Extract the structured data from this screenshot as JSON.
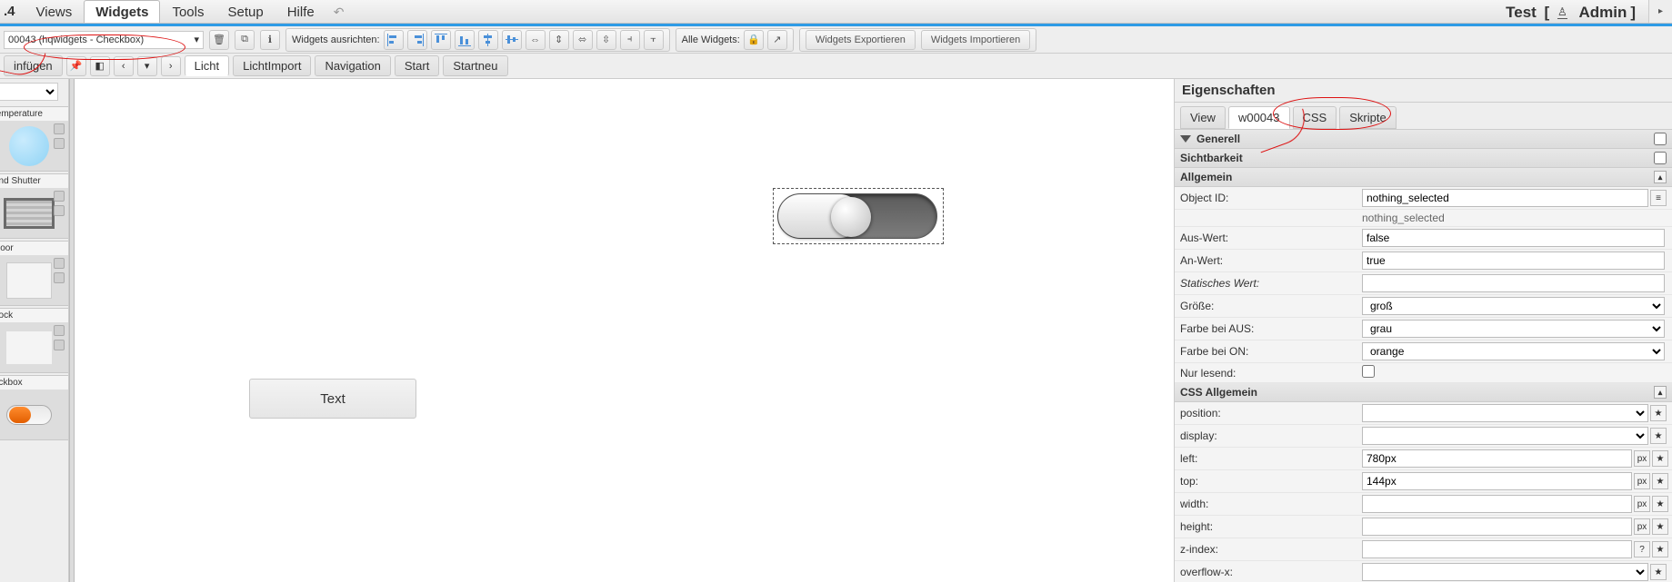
{
  "app": {
    "version": ".4",
    "title_right": "Test",
    "user": "Admin"
  },
  "menu": {
    "views": "Views",
    "widgets": "Widgets",
    "tools": "Tools",
    "setup": "Setup",
    "help": "Hilfe"
  },
  "toolbar2": {
    "widget_selector": "00043 (hqwidgets - Checkbox)",
    "align_label": "Widgets ausrichten:",
    "all_widgets_label": "Alle Widgets:",
    "export": "Widgets Exportieren",
    "import": "Widgets Importieren"
  },
  "tabbar": {
    "insert": "infügen",
    "tabs": [
      "Licht",
      "LichtImport",
      "Navigation",
      "Start",
      "Startneu"
    ],
    "active": 0
  },
  "palette": {
    "items": [
      {
        "label": "temperature"
      },
      {
        "label": "and Shutter"
      },
      {
        "label": "Door"
      },
      {
        "label": "Lock"
      },
      {
        "label": "eckbox"
      }
    ]
  },
  "canvas": {
    "text_widget": "Text"
  },
  "props": {
    "title": "Eigenschaften",
    "tab_view": "View",
    "tab_widget": "w00043",
    "tab_css": "CSS",
    "tab_scripts": "Skripte",
    "active": 1,
    "groups": {
      "general": "Generell",
      "visibility": "Sichtbarkeit",
      "common": "Allgemein",
      "css_common": "CSS Allgemein"
    },
    "common": {
      "oid_label": "Object ID:",
      "oid_value": "nothing_selected",
      "oid_hint": "nothing_selected",
      "off_label": "Aus-Wert:",
      "off_value": "false",
      "on_label": "An-Wert:",
      "on_value": "true",
      "static_label": "Statisches Wert:",
      "static_value": "",
      "size_label": "Größe:",
      "size_value": "groß",
      "off_color_label": "Farbe bei AUS:",
      "off_color_value": "grau",
      "on_color_label": "Farbe bei ON:",
      "on_color_value": "orange",
      "readonly_label": "Nur lesend:"
    },
    "css": {
      "position_label": "position:",
      "position_value": "",
      "display_label": "display:",
      "display_value": "",
      "left_label": "left:",
      "left_value": "780px",
      "top_label": "top:",
      "top_value": "144px",
      "width_label": "width:",
      "width_value": "",
      "height_label": "height:",
      "height_value": "",
      "zindex_label": "z-index:",
      "zindex_value": "",
      "overflowx_label": "overflow-x:",
      "overflowx_value": ""
    },
    "unit_px": "px"
  }
}
